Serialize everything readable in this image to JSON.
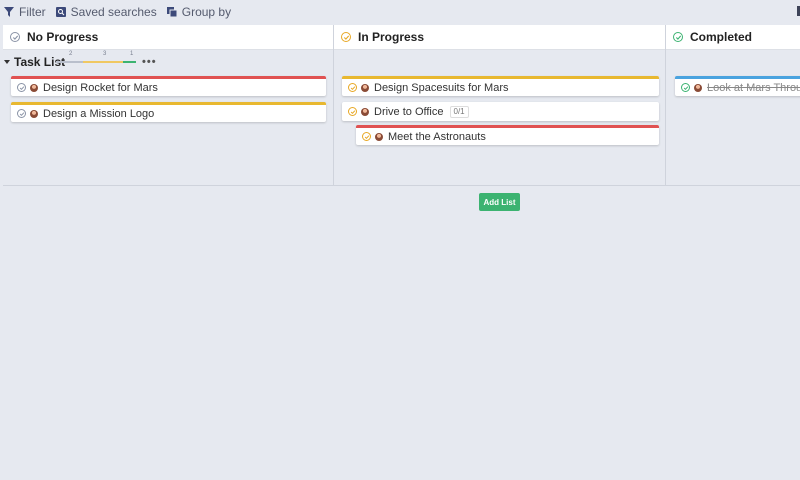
{
  "toolbar": {
    "filter_label": "Filter",
    "saved_searches_label": "Saved searches",
    "group_by_label": "Group by"
  },
  "columns": [
    {
      "title": "No Progress",
      "status_color": "#8a93a6"
    },
    {
      "title": "In Progress",
      "status_color": "#e8a825"
    },
    {
      "title": "Completed",
      "status_color": "#3cb371"
    }
  ],
  "task_list": {
    "label": "Task List",
    "progress_counts": {
      "no_progress": "2",
      "in_progress": "3",
      "completed": "1"
    },
    "more_label": "•••"
  },
  "cards": {
    "c1": [
      {
        "title": "Design Rocket for Mars",
        "priority_color": "#e05252"
      },
      {
        "title": "Design a Mission Logo",
        "priority_color": "#e8b830"
      }
    ],
    "c2": [
      {
        "title": "Design Spacesuits for Mars",
        "priority_color": "#e8b830"
      },
      {
        "title": "Drive to Office",
        "priority_color": "#ffffff",
        "badge": "0/1"
      },
      {
        "title": "Meet the Astronauts",
        "priority_color": "#e05252"
      }
    ],
    "c3": [
      {
        "title": "Look at Mars Through Telescope",
        "priority_color": "#4aa3df"
      }
    ]
  },
  "add_list_label": "Add List"
}
